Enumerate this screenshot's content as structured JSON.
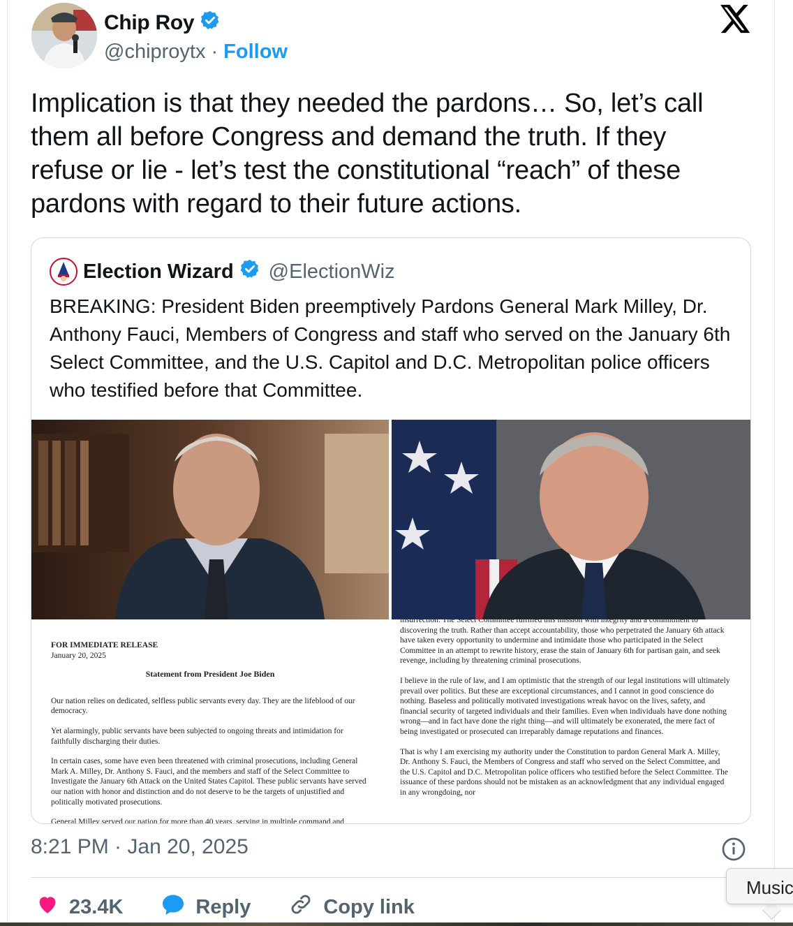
{
  "author": {
    "name": "Chip Roy",
    "handle": "@chiproytx",
    "separator": "·",
    "follow_label": "Follow"
  },
  "tweet": {
    "text": "Implication is that they needed the pardons… So, let’s call them all before Congress and demand the truth.  If they refuse or lie - let’s test the constitutional “reach” of these pardons with regard to their future actions.",
    "timestamp": "8:21 PM · Jan 20, 2025"
  },
  "quoted": {
    "name": "Election Wizard",
    "handle": "@ElectionWiz",
    "text": "BREAKING: President Biden preemptively Pardons General Mark Milley, Dr. Anthony Fauci, Members of Congress and staff who served on the January 6th Select Committee, and the U.S. Capitol and D.C. Metropolitan police officers who testified before that Committee."
  },
  "doc_left": {
    "release": "FOR IMMEDIATE RELEASE",
    "date": "January 20, 2025",
    "title": "Statement from President Joe Biden",
    "p1": "Our nation relies on dedicated, selfless public servants every day.  They are the lifeblood of our democracy.",
    "p2": "Yet alarmingly, public servants have been subjected to ongoing threats and intimidation for faithfully discharging their duties.",
    "p3": "In certain cases, some have even been threatened with criminal prosecutions, including General Mark A. Milley, Dr. Anthony S. Fauci, and the members and staff of the Select Committee to Investigate the January 6th Attack on the United States Capitol. These public servants have served our nation with honor and distinction and do not deserve to be the targets of unjustified and politically motivated prosecutions.",
    "p4": "General Milley served our nation for more than 40 years, serving in multiple command and"
  },
  "doc_right": {
    "p1": "insurrection. The Select Committee fulfilled this mission with integrity and a commitment to discovering the truth.  Rather than accept accountability, those who perpetrated the January 6th attack have taken every opportunity to undermine and intimidate those who participated in the Select Committee in an attempt to rewrite history, erase the stain of January 6th for partisan gain, and seek revenge, including by threatening criminal prosecutions.",
    "p2": "I believe in the rule of law, and I am optimistic that the strength of our legal institutions will ultimately prevail over politics.  But these are exceptional circumstances, and I cannot in good conscience do nothing.  Baseless and politically motivated investigations wreak havoc on the lives, safety, and financial security of targeted individuals and their families.  Even when individuals have done nothing wrong—and in fact have done the right thing—and will ultimately be exonerated, the mere fact of being investigated or prosecuted can irreparably damage reputations and finances.",
    "p3": "That is why I am exercising my authority under the Constitution to pardon General Mark A. Milley, Dr. Anthony S. Fauci, the Members of Congress and staff who served on the Select Committee, and the U.S. Capitol and D.C. Metropolitan police officers who testified before the Select Committee.  The issuance of these pardons should not be mistaken as an acknowledgment that any individual engaged in any wrongdoing, nor"
  },
  "actions": {
    "likes": "23.4K",
    "reply_label": "Reply",
    "copy_label": "Copy link"
  },
  "tooltip": "Music",
  "colors": {
    "accent": "#1d9bf0",
    "like": "#f91880",
    "muted": "#536471"
  },
  "icons": [
    "verified-badge-icon",
    "x-logo-icon",
    "info-icon",
    "heart-icon",
    "reply-bubble-icon",
    "link-icon"
  ]
}
